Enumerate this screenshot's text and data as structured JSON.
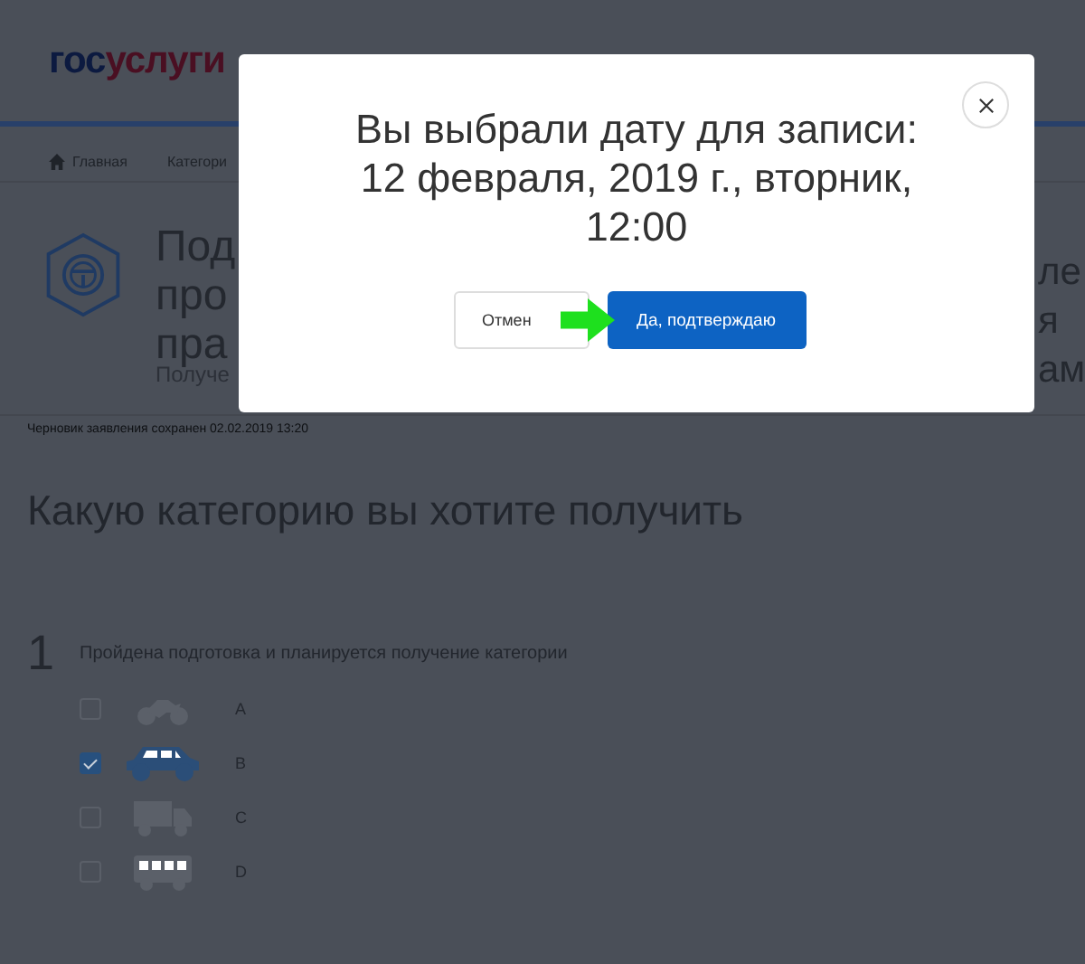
{
  "header": {
    "logo": [
      "гос",
      "услуги"
    ]
  },
  "breadcrumbs": [
    {
      "label": "Главная",
      "home": true
    },
    {
      "label": "Категори",
      "home": false
    }
  ],
  "service": {
    "title_left": [
      "Под",
      "про",
      "пра"
    ],
    "title_right": [
      "ле",
      "я",
      "ам"
    ],
    "subtitle": "Получе"
  },
  "draft_note": "Черновик заявления сохранен 02.02.2019 13:20",
  "question": "Какую категорию вы хотите получить",
  "step": {
    "number": "1",
    "label": "Пройдена подготовка и планируется получение категории"
  },
  "categories": [
    {
      "label": "A",
      "kind": "motorcycle",
      "checked": false
    },
    {
      "label": "B",
      "kind": "car",
      "checked": true
    },
    {
      "label": "C",
      "kind": "truck",
      "checked": false
    },
    {
      "label": "D",
      "kind": "bus",
      "checked": false
    }
  ],
  "modal": {
    "title": [
      "Вы выбрали дату для записи:",
      "12 февраля, 2019 г., вторник,",
      "12:00"
    ],
    "cancel": "Отмен",
    "confirm": "Да, подтверждаю",
    "pointer_arrow": true
  }
}
